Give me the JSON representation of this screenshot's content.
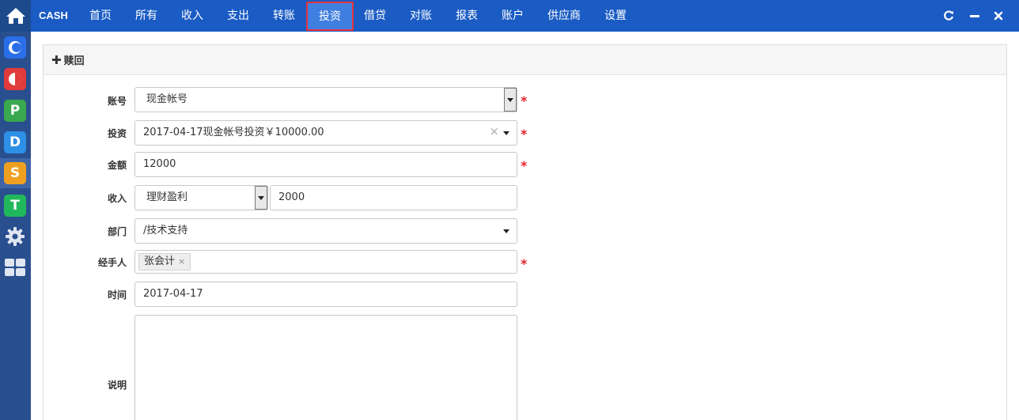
{
  "app": {
    "brand": "CASH"
  },
  "nav": {
    "items": [
      "首页",
      "所有",
      "收入",
      "支出",
      "转账",
      "投资",
      "借贷",
      "对账",
      "报表",
      "账户",
      "供应商",
      "设置"
    ],
    "active": "投资"
  },
  "sidebar": {
    "items": [
      {
        "letter": "C",
        "color": "#2a6fe8"
      },
      {
        "letter": "",
        "color": "#e23b3b"
      },
      {
        "letter": "P",
        "color": "#3aa84e"
      },
      {
        "letter": "D",
        "color": "#2d8fe6"
      },
      {
        "letter": "S",
        "color": "#f0a020"
      },
      {
        "letter": "T",
        "color": "#21b85c"
      }
    ]
  },
  "panel": {
    "title": "赎回"
  },
  "form": {
    "account_label": "账号",
    "account_value": "现金帐号",
    "invest_label": "投资",
    "invest_value": "2017-04-17现金帐号投资￥10000.00",
    "amount_label": "金额",
    "amount_value": "12000",
    "income_label": "收入",
    "income_type": "理财盈利",
    "income_value": "2000",
    "dept_label": "部门",
    "dept_value": "/技术支持",
    "handler_label": "经手人",
    "handler_tag": "张会计",
    "date_label": "时间",
    "date_value": "2017-04-17",
    "note_label": "说明",
    "note_value": ""
  },
  "required_mark": "*",
  "icons": {
    "clear": "×",
    "tag_remove": "×"
  }
}
